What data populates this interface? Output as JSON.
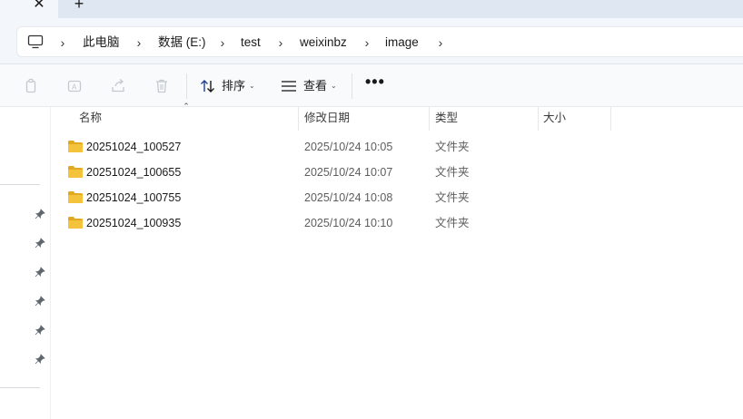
{
  "tabs": {
    "close_glyph": "✕",
    "new_tab_glyph": "+"
  },
  "address": {
    "icon": "computer-icon",
    "crumbs": [
      "此电脑",
      "数据 (E:)",
      "test",
      "weixinbz",
      "image"
    ]
  },
  "toolbar": {
    "disabled_icons": [
      "copy-icon",
      "rename-icon",
      "share-icon",
      "delete-icon"
    ],
    "sort_label": "排序",
    "view_label": "查看",
    "more_glyph": "•••"
  },
  "columns": {
    "name": "名称",
    "modified": "修改日期",
    "type": "类型",
    "size": "大小"
  },
  "files": [
    {
      "name": "20251024_100527",
      "modified": "2025/10/24 10:05",
      "type": "文件夹"
    },
    {
      "name": "20251024_100655",
      "modified": "2025/10/24 10:07",
      "type": "文件夹"
    },
    {
      "name": "20251024_100755",
      "modified": "2025/10/24 10:08",
      "type": "文件夹"
    },
    {
      "name": "20251024_100935",
      "modified": "2025/10/24 10:10",
      "type": "文件夹"
    }
  ],
  "colors": {
    "folder_yellow": "#f5c33b",
    "folder_dark": "#e2a91f",
    "tab_strip": "#dfe7f3",
    "disabled_icon": "#c4c9d0"
  }
}
